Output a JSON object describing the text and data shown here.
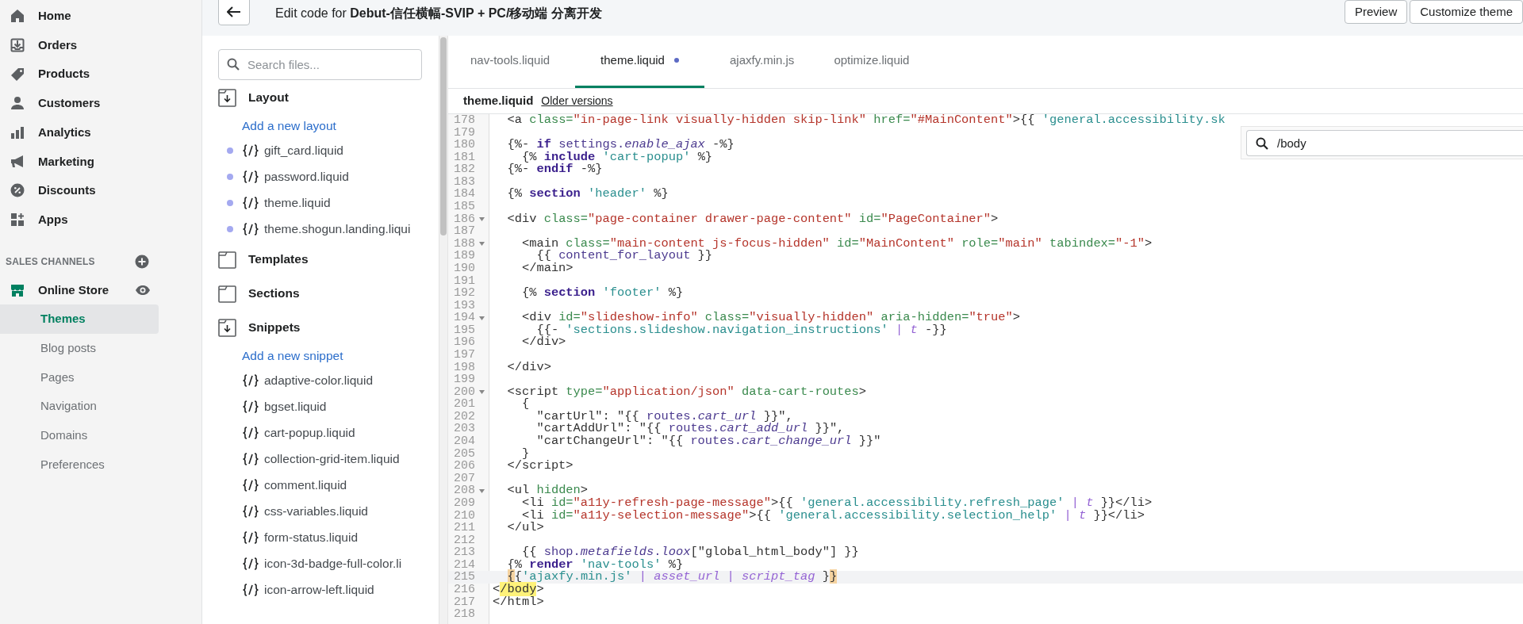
{
  "top_bar": {
    "title": "Edit code for **Debut-信任横幅-SVIP + PC/移动端 分离开发**",
    "buttons": [
      "Preview",
      "Customize theme"
    ]
  },
  "sidebar": {
    "items": [
      {
        "label": "Home"
      },
      {
        "label": "Orders"
      },
      {
        "label": "Products"
      },
      {
        "label": "Customers"
      },
      {
        "label": "Analytics"
      },
      {
        "label": "Marketing"
      },
      {
        "label": "Discounts"
      },
      {
        "label": "Apps"
      }
    ],
    "sales_channels": {
      "heading": "SALES CHANNELS",
      "channel": "Online Store",
      "sub_items": [
        {
          "label": "Themes",
          "selected": true
        },
        {
          "label": "Blog posts",
          "selected": false
        },
        {
          "label": "Pages",
          "selected": false
        },
        {
          "label": "Navigation",
          "selected": false
        },
        {
          "label": "Domains",
          "selected": false
        },
        {
          "label": "Preferences",
          "selected": false
        }
      ]
    }
  },
  "file_browser": {
    "search": {
      "placeholder": "Search files..."
    },
    "folders": [
      {
        "name": "Layout",
        "expanded": true,
        "add_link": "Add a new layout",
        "files": [
          {
            "name": "gift_card.liquid",
            "dot": true
          },
          {
            "name": "password.liquid",
            "dot": true
          },
          {
            "name": "theme.liquid",
            "dot": true
          },
          {
            "name": "theme.shogun.landing.liqui",
            "dot": true
          }
        ]
      },
      {
        "name": "Templates",
        "expanded": false
      },
      {
        "name": "Sections",
        "expanded": false
      },
      {
        "name": "Snippets",
        "expanded": true,
        "add_link": "Add a new snippet",
        "files": [
          {
            "name": "adaptive-color.liquid",
            "dot": false
          },
          {
            "name": "bgset.liquid",
            "dot": false
          },
          {
            "name": "cart-popup.liquid",
            "dot": false
          },
          {
            "name": "collection-grid-item.liquid",
            "dot": false
          },
          {
            "name": "comment.liquid",
            "dot": false
          },
          {
            "name": "css-variables.liquid",
            "dot": false
          },
          {
            "name": "form-status.liquid",
            "dot": false
          },
          {
            "name": "icon-3d-badge-full-color.li",
            "dot": false
          },
          {
            "name": "icon-arrow-left.liquid",
            "dot": false
          }
        ]
      }
    ]
  },
  "editor": {
    "tabs": [
      {
        "label": "nav-tools.liquid",
        "selected": false,
        "unsaved": false
      },
      {
        "label": "theme.liquid",
        "selected": true,
        "unsaved": true
      },
      {
        "label": "ajaxfy.min.js",
        "selected": false,
        "unsaved": false
      },
      {
        "label": "optimize.liquid",
        "selected": false,
        "unsaved": false
      }
    ],
    "file_title": "theme.liquid",
    "older_versions": "Older versions",
    "find": {
      "value": "/body"
    },
    "lines": [
      {
        "number": "178",
        "fold": false,
        "active": false,
        "segments": [
          {
            "kind": "p",
            "text": "  <a "
          },
          {
            "kind": "attr",
            "text": "class="
          },
          {
            "kind": "str",
            "text": "\"in-page-link visually-hidden skip-link\""
          },
          {
            "kind": "attr",
            "text": " href="
          },
          {
            "kind": "str",
            "text": "\"#MainContent\""
          },
          {
            "kind": "p",
            "text": ">{{ "
          },
          {
            "kind": "lstr",
            "text": "'general.accessibility.sk"
          }
        ]
      },
      {
        "number": "179",
        "fold": false,
        "active": false
      },
      {
        "number": "180",
        "fold": false,
        "active": false,
        "segments": [
          {
            "kind": "p",
            "text": "  {%- "
          },
          {
            "kind": "kw",
            "text": "if"
          },
          {
            "kind": "var",
            "text": " settings."
          },
          {
            "kind": "ital",
            "text": "enable_ajax"
          },
          {
            "kind": "p",
            "text": " -%}"
          }
        ]
      },
      {
        "number": "181",
        "fold": false,
        "active": false,
        "segments": [
          {
            "kind": "p",
            "text": "    {% "
          },
          {
            "kind": "kw",
            "text": "include"
          },
          {
            "kind": "lstr",
            "text": " 'cart-popup'"
          },
          {
            "kind": "p",
            "text": " %}"
          }
        ]
      },
      {
        "number": "182",
        "fold": false,
        "active": false,
        "segments": [
          {
            "kind": "p",
            "text": "  {%- "
          },
          {
            "kind": "kw",
            "text": "endif"
          },
          {
            "kind": "p",
            "text": " -%}"
          }
        ]
      },
      {
        "number": "183",
        "fold": false,
        "active": false
      },
      {
        "number": "184",
        "fold": false,
        "active": false,
        "segments": [
          {
            "kind": "p",
            "text": "  {% "
          },
          {
            "kind": "kw",
            "text": "section"
          },
          {
            "kind": "lstr",
            "text": " 'header'"
          },
          {
            "kind": "p",
            "text": " %}"
          }
        ]
      },
      {
        "number": "185",
        "fold": false,
        "active": false
      },
      {
        "number": "186",
        "fold": true,
        "active": false,
        "segments": [
          {
            "kind": "p",
            "text": "  <div "
          },
          {
            "kind": "attr",
            "text": "class="
          },
          {
            "kind": "str",
            "text": "\"page-container drawer-page-content\""
          },
          {
            "kind": "attr",
            "text": " id="
          },
          {
            "kind": "str",
            "text": "\"PageContainer\""
          },
          {
            "kind": "p",
            "text": ">"
          }
        ]
      },
      {
        "number": "187",
        "fold": false,
        "active": false
      },
      {
        "number": "188",
        "fold": true,
        "active": false,
        "segments": [
          {
            "kind": "p",
            "text": "    <main "
          },
          {
            "kind": "attr",
            "text": "class="
          },
          {
            "kind": "str",
            "text": "\"main-content js-focus-hidden\""
          },
          {
            "kind": "attr",
            "text": " id="
          },
          {
            "kind": "str",
            "text": "\"MainContent\""
          },
          {
            "kind": "attr",
            "text": " role="
          },
          {
            "kind": "str",
            "text": "\"main\""
          },
          {
            "kind": "attr",
            "text": " tabindex="
          },
          {
            "kind": "str",
            "text": "\"-1\""
          },
          {
            "kind": "p",
            "text": ">"
          }
        ]
      },
      {
        "number": "189",
        "fold": false,
        "active": false,
        "segments": [
          {
            "kind": "p",
            "text": "      {{ "
          },
          {
            "kind": "var",
            "text": "content_for_layout"
          },
          {
            "kind": "p",
            "text": " }}"
          }
        ]
      },
      {
        "number": "190",
        "fold": false,
        "active": false,
        "segments": [
          {
            "kind": "p",
            "text": "    </main>"
          }
        ]
      },
      {
        "number": "191",
        "fold": false,
        "active": false
      },
      {
        "number": "192",
        "fold": false,
        "active": false,
        "segments": [
          {
            "kind": "p",
            "text": "    {% "
          },
          {
            "kind": "kw",
            "text": "section"
          },
          {
            "kind": "lstr",
            "text": " 'footer'"
          },
          {
            "kind": "p",
            "text": " %}"
          }
        ]
      },
      {
        "number": "193",
        "fold": false,
        "active": false
      },
      {
        "number": "194",
        "fold": true,
        "active": false,
        "segments": [
          {
            "kind": "p",
            "text": "    <div "
          },
          {
            "kind": "attr",
            "text": "id="
          },
          {
            "kind": "str",
            "text": "\"slideshow-info\""
          },
          {
            "kind": "attr",
            "text": " class="
          },
          {
            "kind": "str",
            "text": "\"visually-hidden\""
          },
          {
            "kind": "attr",
            "text": " aria-hidden="
          },
          {
            "kind": "str",
            "text": "\"true\""
          },
          {
            "kind": "p",
            "text": ">"
          }
        ]
      },
      {
        "number": "195",
        "fold": false,
        "active": false,
        "segments": [
          {
            "kind": "p",
            "text": "      {{- "
          },
          {
            "kind": "lstr",
            "text": "'sections.slideshow.navigation_instructions'"
          },
          {
            "kind": "filter",
            "text": " | t"
          },
          {
            "kind": "p",
            "text": " -}}"
          }
        ]
      },
      {
        "number": "196",
        "fold": false,
        "active": false,
        "segments": [
          {
            "kind": "p",
            "text": "    </div>"
          }
        ]
      },
      {
        "number": "197",
        "fold": false,
        "active": false
      },
      {
        "number": "198",
        "fold": false,
        "active": false,
        "segments": [
          {
            "kind": "p",
            "text": "  </div>"
          }
        ]
      },
      {
        "number": "199",
        "fold": false,
        "active": false
      },
      {
        "number": "200",
        "fold": true,
        "active": false,
        "segments": [
          {
            "kind": "p",
            "text": "  <script "
          },
          {
            "kind": "attr",
            "text": "type="
          },
          {
            "kind": "str",
            "text": "\"application/json\""
          },
          {
            "kind": "attr",
            "text": " data-cart-routes"
          },
          {
            "kind": "p",
            "text": ">"
          }
        ]
      },
      {
        "number": "201",
        "fold": false,
        "active": false,
        "segments": [
          {
            "kind": "p",
            "text": "    {"
          }
        ]
      },
      {
        "number": "202",
        "fold": false,
        "active": false,
        "segments": [
          {
            "kind": "p",
            "text": "      \"cartUrl\": \"{{ "
          },
          {
            "kind": "var",
            "text": "routes."
          },
          {
            "kind": "ital",
            "text": "cart_url"
          },
          {
            "kind": "p",
            "text": " }}\","
          }
        ]
      },
      {
        "number": "203",
        "fold": false,
        "active": false,
        "segments": [
          {
            "kind": "p",
            "text": "      \"cartAddUrl\": \"{{ "
          },
          {
            "kind": "var",
            "text": "routes."
          },
          {
            "kind": "ital",
            "text": "cart_add_url"
          },
          {
            "kind": "p",
            "text": " }}\","
          }
        ]
      },
      {
        "number": "204",
        "fold": false,
        "active": false,
        "segments": [
          {
            "kind": "p",
            "text": "      \"cartChangeUrl\": \"{{ "
          },
          {
            "kind": "var",
            "text": "routes."
          },
          {
            "kind": "ital",
            "text": "cart_change_url"
          },
          {
            "kind": "p",
            "text": " }}\""
          }
        ]
      },
      {
        "number": "205",
        "fold": false,
        "active": false,
        "segments": [
          {
            "kind": "p",
            "text": "    }"
          }
        ]
      },
      {
        "number": "206",
        "fold": false,
        "active": false,
        "segments": [
          {
            "kind": "p",
            "text": "  </script>"
          }
        ]
      },
      {
        "number": "207",
        "fold": false,
        "active": false
      },
      {
        "number": "208",
        "fold": true,
        "active": false,
        "segments": [
          {
            "kind": "p",
            "text": "  <ul "
          },
          {
            "kind": "attr",
            "text": "hidden"
          },
          {
            "kind": "p",
            "text": ">"
          }
        ]
      },
      {
        "number": "209",
        "fold": false,
        "active": false,
        "segments": [
          {
            "kind": "p",
            "text": "    <li "
          },
          {
            "kind": "attr",
            "text": "id="
          },
          {
            "kind": "str",
            "text": "\"a11y-refresh-page-message\""
          },
          {
            "kind": "p",
            "text": ">{{ "
          },
          {
            "kind": "lstr",
            "text": "'general.accessibility.refresh_page'"
          },
          {
            "kind": "filter",
            "text": " | t"
          },
          {
            "kind": "p",
            "text": " }}</li>"
          }
        ]
      },
      {
        "number": "210",
        "fold": false,
        "active": false,
        "segments": [
          {
            "kind": "p",
            "text": "    <li "
          },
          {
            "kind": "attr",
            "text": "id="
          },
          {
            "kind": "str",
            "text": "\"a11y-selection-message\""
          },
          {
            "kind": "p",
            "text": ">{{ "
          },
          {
            "kind": "lstr",
            "text": "'general.accessibility.selection_help'"
          },
          {
            "kind": "filter",
            "text": " | t"
          },
          {
            "kind": "p",
            "text": " }}</li>"
          }
        ]
      },
      {
        "number": "211",
        "fold": false,
        "active": false,
        "segments": [
          {
            "kind": "p",
            "text": "  </ul>"
          }
        ]
      },
      {
        "number": "212",
        "fold": false,
        "active": false
      },
      {
        "number": "213",
        "fold": false,
        "active": false,
        "segments": [
          {
            "kind": "p",
            "text": "    {{ "
          },
          {
            "kind": "var",
            "text": "shop."
          },
          {
            "kind": "ital",
            "text": "metafields"
          },
          {
            "kind": "var",
            "text": "."
          },
          {
            "kind": "ital",
            "text": "loox"
          },
          {
            "kind": "p",
            "text": "[\"global_html_body\"] }}"
          }
        ]
      },
      {
        "number": "214",
        "fold": false,
        "active": false,
        "segments": [
          {
            "kind": "p",
            "text": "  {% "
          },
          {
            "kind": "kw",
            "text": "render"
          },
          {
            "kind": "lstr",
            "text": " 'nav-tools'"
          },
          {
            "kind": "p",
            "text": " %}"
          }
        ]
      },
      {
        "number": "215",
        "fold": false,
        "active": true,
        "indent": true,
        "segments": [
          {
            "kind": "match",
            "text": "{"
          },
          {
            "kind": "p",
            "text": "{"
          },
          {
            "kind": "lstr",
            "text": "'ajaxfy.min.js'"
          },
          {
            "kind": "filter",
            "text": " | asset_url | script_tag"
          },
          {
            "kind": "p",
            "text": " }"
          },
          {
            "kind": "match",
            "text": "}"
          }
        ]
      },
      {
        "number": "216",
        "fold": false,
        "active": false,
        "segments": [
          {
            "kind": "p",
            "text": "<"
          },
          {
            "kind": "find",
            "text": "/body"
          },
          {
            "kind": "p",
            "text": ">"
          }
        ]
      },
      {
        "number": "217",
        "fold": false,
        "active": false,
        "segments": [
          {
            "kind": "p",
            "text": "</html>"
          }
        ]
      },
      {
        "number": "218",
        "fold": false,
        "active": false
      }
    ]
  }
}
